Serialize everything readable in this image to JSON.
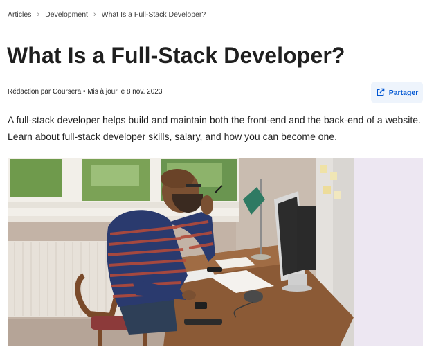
{
  "breadcrumb": {
    "items": [
      "Articles",
      "Development",
      "What Is a Full-Stack Developer?"
    ],
    "separator": "›"
  },
  "article": {
    "title": "What Is a Full-Stack Developer?",
    "meta": "Rédaction par Coursera • Mis à jour le 8 nov. 2023",
    "share_label": "Partager",
    "description": "A full-stack developer helps build and maintain both the front-end and the back-end of a website. Learn about full-stack developer skills, salary, and how you can become one."
  },
  "icons": {
    "share": "share-external-icon"
  },
  "colors": {
    "accent": "#0056d2",
    "share_bg": "#eef4fc",
    "text": "#1f1f1f"
  }
}
